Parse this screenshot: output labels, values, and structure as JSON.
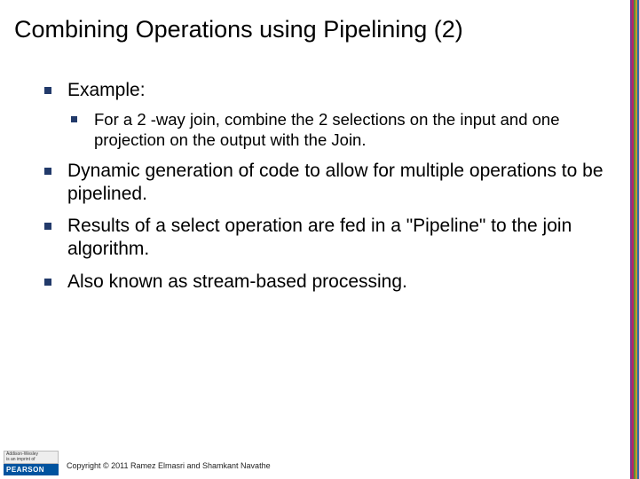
{
  "title": "Combining Operations using Pipelining (2)",
  "bullets": {
    "b0": {
      "label": "Example:",
      "sub": {
        "s0": "For a 2 -way join, combine the 2 selections on the input and one projection on the output with the Join."
      }
    },
    "b1": "Dynamic generation of code to allow for multiple operations to be pipelined.",
    "b2": "Results of a select operation are fed in a \"Pipeline\" to the join algorithm.",
    "b3": "Also known as stream-based processing."
  },
  "publisher": {
    "imprint_line1": "Addison-Wesley",
    "imprint_line2": "is an imprint of",
    "brand": "PEARSON"
  },
  "copyright": "Copyright © 2011 Ramez Elmasri and Shamkant Navathe"
}
